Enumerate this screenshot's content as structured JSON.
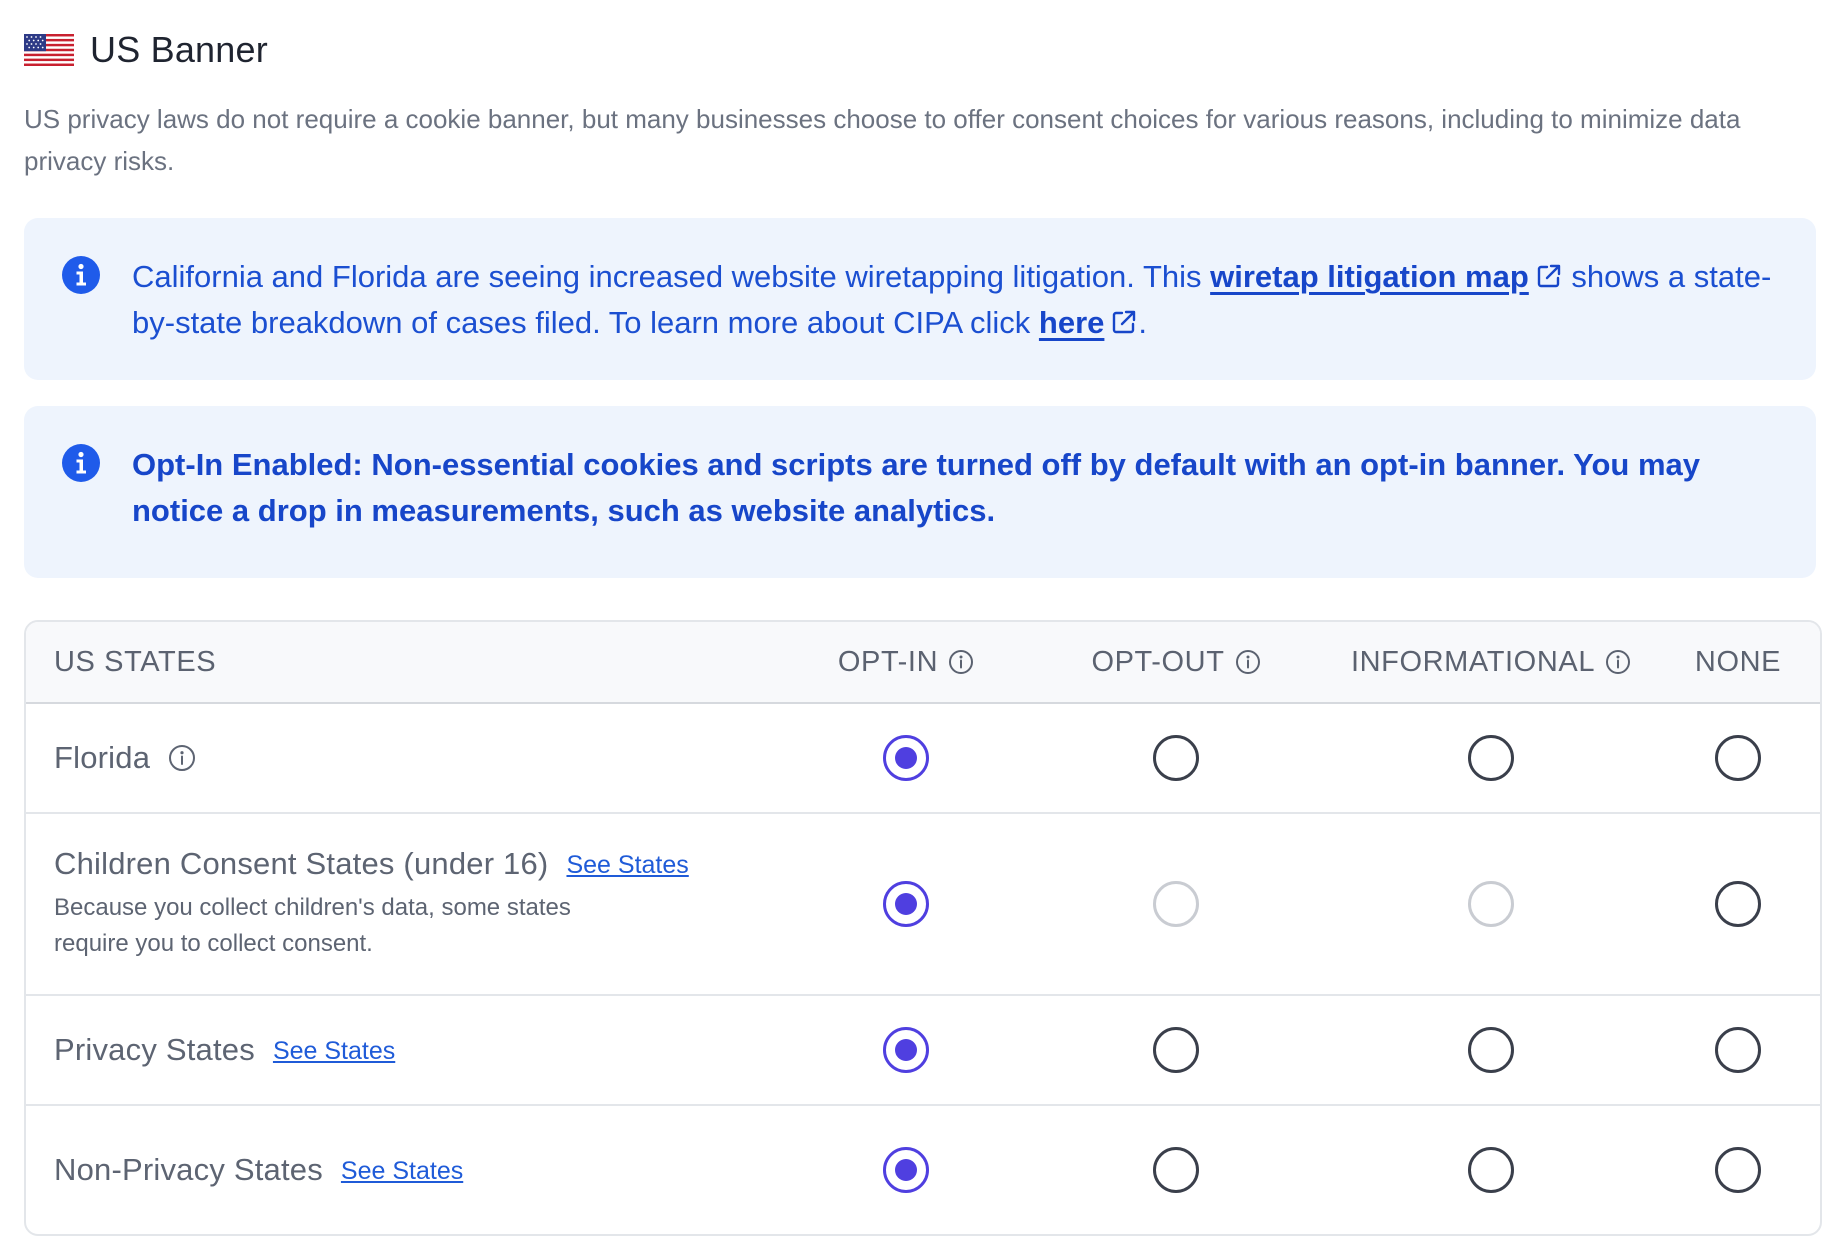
{
  "header": {
    "title": "US Banner",
    "flag_icon": "us-flag-icon"
  },
  "description": "US privacy laws do not require a cookie banner, but many businesses choose to offer consent choices for various reasons, including to minimize data privacy risks.",
  "notices": {
    "wiretap": {
      "text_before": "California and Florida are seeing increased website wiretapping litigation. This ",
      "link1": "wiretap litigation map",
      "text_middle": " shows a state-by-state breakdown of cases filed. To learn more about CIPA click ",
      "link2": "here",
      "text_after": "."
    },
    "optin": {
      "text": "Opt-In Enabled: Non-essential cookies and scripts are turned off by default with an opt-in banner. You may notice a drop in measurements, such as website analytics."
    }
  },
  "table": {
    "columns": {
      "states": "US STATES",
      "optin": "OPT-IN",
      "optout": "OPT-OUT",
      "informational": "INFORMATIONAL",
      "none": "NONE"
    },
    "rows": [
      {
        "label": "Florida",
        "see_states": "",
        "sub": "",
        "selected": "optin",
        "disabled": []
      },
      {
        "label": "Children Consent States (under 16)",
        "see_states": "See States",
        "sub": "Because you collect children's data, some states require you to collect consent.",
        "selected": "optin",
        "disabled": [
          "optout",
          "informational"
        ]
      },
      {
        "label": "Privacy States",
        "see_states": "See States",
        "sub": "",
        "selected": "optin",
        "disabled": []
      },
      {
        "label": "Non-Privacy States",
        "see_states": "See States",
        "sub": "",
        "selected": "optin",
        "disabled": []
      }
    ]
  },
  "colors": {
    "accent": "#4f3fe0",
    "link": "#1f5bd8",
    "notice_bg": "#eef4fd",
    "notice_text": "#1746c9"
  }
}
